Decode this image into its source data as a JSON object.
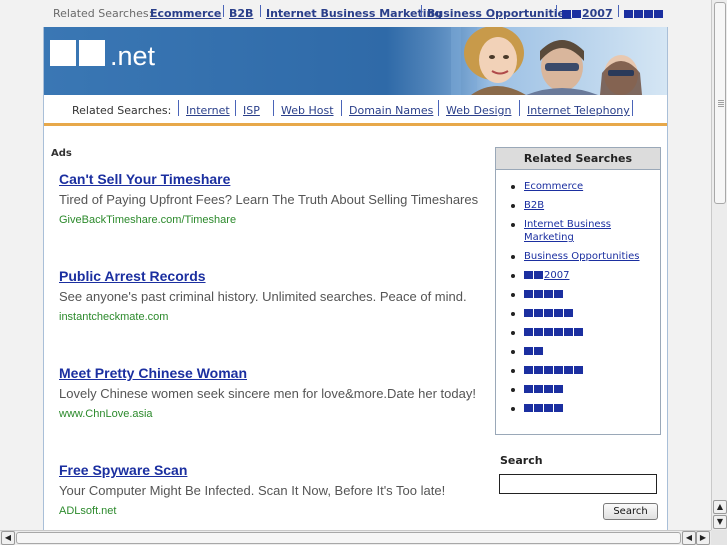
{
  "top_related": {
    "label": "Related Searches:",
    "links": [
      "Ecommerce",
      "B2B",
      "Internet Business Marketing",
      "Business Opportunities",
      "2007"
    ]
  },
  "header": {
    "tld": ".net"
  },
  "nav": {
    "label": "Related Searches:",
    "links": [
      "Internet",
      "ISP",
      "Web Host",
      "Domain Names",
      "Web Design",
      "Internet Telephony"
    ]
  },
  "ads_label": "Ads",
  "ads": [
    {
      "title": "Can't Sell Your Timeshare",
      "desc": "Tired of Paying Upfront Fees? Learn The Truth About Selling Timeshares",
      "url": "GiveBackTimeshare.com/Timeshare"
    },
    {
      "title": "Public Arrest Records",
      "desc": "See anyone's past criminal history. Unlimited searches. Peace of mind.",
      "url": "instantcheckmate.com"
    },
    {
      "title": "Meet Pretty Chinese Woman",
      "desc": "Lovely Chinese women seek sincere men for love&more.Date her today!",
      "url": "www.ChnLove.asia"
    },
    {
      "title": "Free Spyware Scan",
      "desc": "Your Computer Might Be Infected. Scan It Now, Before It's Too late!",
      "url": "ADLsoft.net"
    }
  ],
  "sidebar": {
    "title": "Related Searches",
    "items": [
      "Ecommerce",
      "B2B",
      "Internet Business Marketing",
      "Business Opportunities",
      "2007",
      "",
      "",
      "",
      "",
      "",
      "",
      ""
    ]
  },
  "search": {
    "label": "Search",
    "value": "",
    "button": "Search"
  },
  "colors": {
    "link": "#1b2fa0",
    "url_green": "#2c8a2c",
    "accent_orange": "#e7a84a",
    "header_blue": "#2f6aa8"
  }
}
